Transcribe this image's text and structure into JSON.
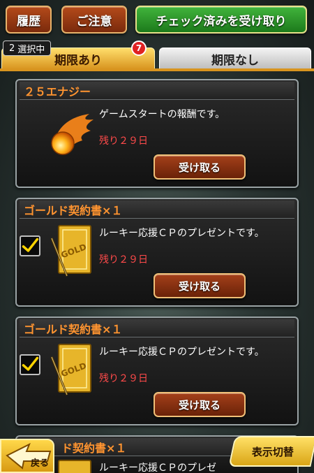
{
  "toolbar": {
    "history_label": "履歴",
    "notice_label": "ご注意",
    "receive_checked_label": "チェック済みを受け取り"
  },
  "tabs": {
    "selected_count": "2",
    "selected_suffix": "選択中",
    "active_label": "期限あり",
    "active_badge": "7",
    "inactive_label": "期限なし"
  },
  "presents": [
    {
      "title": "２５エナジー",
      "description": "ゲームスタートの報酬です。",
      "remaining": "残り２９日",
      "button": "受け取る",
      "icon": "energy-fireball-icon",
      "checked": false
    },
    {
      "title": "ゴールド契約書×１",
      "description": "ルーキー応援ＣＰのプレゼントです。",
      "remaining": "残り２９日",
      "button": "受け取る",
      "icon": "gold-contract-icon",
      "checked": true
    },
    {
      "title": "ゴールド契約書×１",
      "description": "ルーキー応援ＣＰのプレゼントです。",
      "remaining": "残り２９日",
      "button": "受け取る",
      "icon": "gold-contract-icon",
      "checked": true
    },
    {
      "title": "ド契約書×１",
      "description": "ルーキー応援ＣＰのプレゼ",
      "icon": "gold-contract-icon"
    }
  ],
  "bottom": {
    "back_label": "戻る",
    "toggle_label": "表示切替"
  },
  "colors": {
    "title_orange": "#ff9430",
    "remain_red": "#ff4a4a",
    "tab_gold": "#d8941f",
    "green_button": "#41b43c"
  }
}
